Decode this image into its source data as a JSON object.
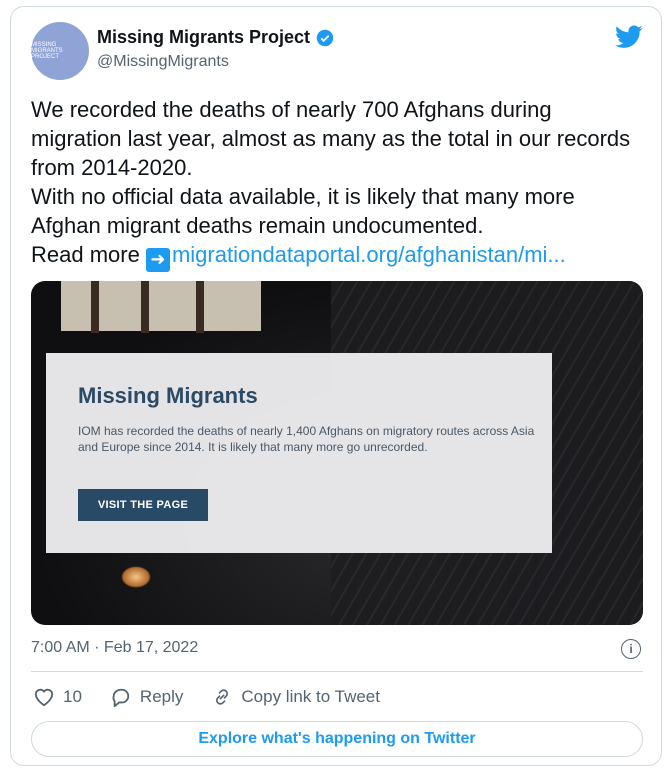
{
  "user": {
    "name": "Missing Migrants Project",
    "handle": "@MissingMigrants",
    "avatar_text": "MISSING MIGRANTS PROJECT"
  },
  "tweet": {
    "line1": "We recorded the deaths of nearly 700 Afghans during migration last year, almost as many as the total in our records from 2014-2020.",
    "line2": "With no official data available, it is likely that many more Afghan migrant deaths remain undocumented.",
    "read_more": "Read more",
    "link": "migrationdataportal.org/afghanistan/mi..."
  },
  "media": {
    "title": "Missing Migrants",
    "description": "IOM has recorded the deaths of nearly 1,400 Afghans on migratory routes across Asia and Europe since 2014. It is likely that many more go unrecorded.",
    "button": "VISIT THE PAGE"
  },
  "meta": {
    "timestamp": "7:00 AM · Feb 17, 2022"
  },
  "actions": {
    "likes": "10",
    "reply": "Reply",
    "copy_link": "Copy link to Tweet"
  },
  "explore": "Explore what's happening on Twitter",
  "colors": {
    "accent": "#1d9bf0",
    "overlay_title": "#2b4a66",
    "button_bg": "#294a66"
  }
}
